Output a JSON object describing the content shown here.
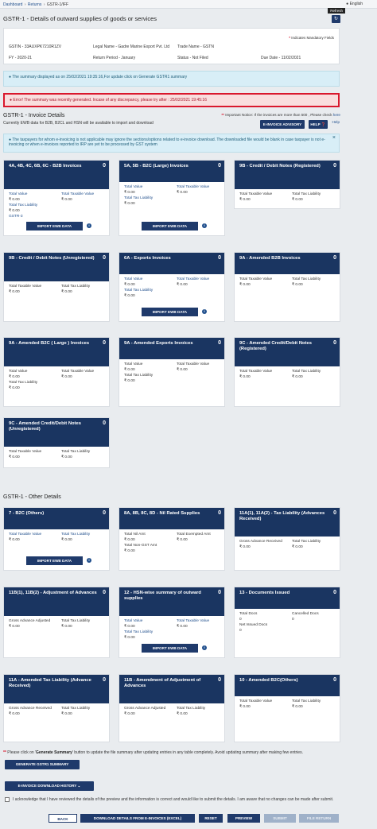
{
  "breadcrumb": {
    "items": [
      "Dashboard",
      "Returns",
      "GSTR-1/IFF"
    ],
    "sep": "›"
  },
  "language": "English",
  "refresh_tooltip": "Refresh",
  "refresh_glyph": "↻",
  "page_title": "GSTR-1 - Details of outward supplies of goods or services",
  "info": {
    "mandatory_star": "*",
    "mandatory": "Indicates Mandatory Fields",
    "gstin": "GSTIN - 33AUXPK7210R1ZV",
    "legal_name": "Legal Name - Gadre Marine Export Pvt. Ltd",
    "trade_name": "Trade Name - GSTN",
    "fy": "FY - 2020-21",
    "return_period": "Return Period - January",
    "status": "Status - Not Filed",
    "due_date": "Due Date - 11/02/2021"
  },
  "alert_summary": "The summary displayed as on 25/02/2021 19:35:16,For update click on Generate GSTR1 summary",
  "alert_error": "Error! The summary was recently generated. Incase of any discrepancy, please try after : 25/02/2021 19:45:16",
  "invoice_section": {
    "title": "GSTR-1 - Invoice Details",
    "subtitle": "Currently EWB data for B2B, B2CL and HSN will be available to import and download",
    "notice_stars": "**",
    "notice": "Important Notice: If the invoices are more than 500 , Please check",
    "notice_link": "here",
    "einvoice_btn": "E-INVOICE ADVISORY",
    "help_btn": "HELP",
    "help_icon": "❓",
    "help_text": "Help"
  },
  "alert_einvoice": "The taxpayers for whom e-invoicing is not applicable may ignore the sections/options related to e-invoice download. The downloaded file would be blank in case taxpayer is not e-invoicing or when e-invoices reported to IRP are yet to be processed by GST system",
  "tiles": [
    {
      "title": "4A, 4B, 4C, 6B, 6C - B2B Invoices",
      "count": "0",
      "l1": "Total Value",
      "v1": "₹ 0.00",
      "l2": "Total Taxable Value",
      "v2": "₹ 0.00",
      "l3": "Total Tax Liability",
      "v3": "₹ 0.00",
      "extra": "GSTR-3",
      "btn": "IMPORT EWB DATA"
    },
    {
      "title": "5A, 5B - B2C (Large) Invoices",
      "count": "0",
      "l1": "Total Value",
      "v1": "₹ 0.00",
      "l2": "Total Taxable Value",
      "v2": "₹ 0.00",
      "l3": "Total Tax Liability",
      "v3": "₹ 0.00",
      "btn": "IMPORT EWB DATA"
    },
    {
      "title": "9B - Credit / Debit Notes (Registered)",
      "count": "0",
      "l1": "Total Taxable Value",
      "v1": "₹ 0.00",
      "l2": "Total Tax Liability",
      "v2": "₹ 0.00"
    },
    {
      "title": "9B - Credit / Debit Notes (Unregistered)",
      "count": "0",
      "l1": "Total Taxable Value",
      "v1": "₹ 0.00",
      "l2": "Total Tax Liability",
      "v2": "₹ 0.00"
    },
    {
      "title": "6A - Exports Invoices",
      "count": "0",
      "l1": "Total Value",
      "v1": "₹ 0.00",
      "l2": "Total Taxable Value",
      "v2": "₹ 0.00",
      "l3": "Total Tax Liability",
      "v3": "₹ 0.00",
      "btn": "IMPORT EWB DATA"
    },
    {
      "title": "9A - Amended B2B Invoices",
      "count": "0",
      "l1": "Total Taxable Value",
      "v1": "₹ 0.00",
      "l2": "Total Tax Liability",
      "v2": "₹ 0.00"
    },
    {
      "title": "9A - Amended B2C ( Large ) Invoices",
      "count": "0",
      "l1": "Total Value",
      "v1": "₹ 0.00",
      "l2": "Total Taxable Value",
      "v2": "₹ 0.00",
      "l3": "Total Tax Liability",
      "v3": "₹ 0.00"
    },
    {
      "title": "9A - Amended Exports Invoices",
      "count": "0",
      "l1": "Total Value",
      "v1": "₹ 0.00",
      "l2": "Total Taxable Value",
      "v2": "₹ 0.00",
      "l3": "Total Tax Liability",
      "v3": "₹ 0.00"
    },
    {
      "title": "9C - Amended Credit/Debit Notes (Registered)",
      "count": "0",
      "l1": "Total Taxable Value",
      "v1": "₹ 0.00",
      "l2": "Total Tax Liability",
      "v2": "₹ 0.00"
    },
    {
      "title": "9C - Amended Credit/Debit Notes (Unregistered)",
      "count": "0",
      "l1": "Total Taxable Value",
      "v1": "₹ 0.00",
      "l2": "Total Tax Liability",
      "v2": "₹ 0.00"
    }
  ],
  "other_section_title": "GSTR-1 - Other Details",
  "other_tiles": [
    {
      "title": "7 - B2C (Others)",
      "count": "0",
      "l1": "Total Taxable Value",
      "v1": "₹ 0.00",
      "l2": "Total Tax Liability",
      "v2": "₹ 0.00",
      "btn": "IMPORT EWB DATA"
    },
    {
      "title": "8A, 8B, 8C, 8D - Nil Rated Supplies",
      "count": "0",
      "l1": "Total Nil Amt",
      "v1": "₹ 0.00",
      "l2": "Total Exempted Amt",
      "v2": "₹ 0.00",
      "l3": "Total Non-GST Amt",
      "v3": "₹ 0.00"
    },
    {
      "title": "11A(1), 11A(2) - Tax Liability (Advances Received)",
      "count": "0",
      "l1": "Gross Advance Received",
      "v1": "₹ 0.00",
      "l2": "Total Tax Liability",
      "v2": "₹ 0.00"
    },
    {
      "title": "11B(1), 11B(2) - Adjustment of Advances",
      "count": "0",
      "l1": "Gross Advance Adjusted",
      "v1": "₹ 0.00",
      "l2": "Total Tax Liability",
      "v2": "₹ 0.00"
    },
    {
      "title": "12 - HSN-wise summary of outward supplies",
      "count": "0",
      "l1": "Total Value",
      "v1": "₹ 0.00",
      "l2": "Total Taxable Value",
      "v2": "₹ 0.00",
      "l3": "Total Tax Liability",
      "v3": "₹ 0.00",
      "btn": "IMPORT EWB DATA"
    },
    {
      "title": "13 - Documents Issued",
      "count": "0",
      "l1": "Total Docs",
      "v1": "0",
      "l2": "Cancelled Docs",
      "v2": "0",
      "l3": "Net Issued Docs",
      "v3": "0"
    },
    {
      "title": "11A - Amended Tax Liability (Advance Received)",
      "count": "0",
      "l1": "Gross Advance Received",
      "v1": "₹ 0.00",
      "l2": "Total Tax Liability",
      "v2": "₹ 0.00"
    },
    {
      "title": "11B - Amendment of Adjustment of Advances",
      "count": "0",
      "l1": "Gross Advance Adjusted",
      "v1": "₹ 0.00",
      "l2": "Total Tax Liability",
      "v2": "₹ 0.00"
    },
    {
      "title": "10 - Amended B2C(Others)",
      "count": "0",
      "l1": "Total Taxable Value",
      "v1": "₹ 0.00",
      "l2": "Total Tax Liability",
      "v2": "₹ 0.00"
    }
  ],
  "footer": {
    "note_stars": "**",
    "note_pre": "Please click on '",
    "note_bold": "Generate Summary",
    "note_post": "' button to update the file summary after updating entries in any table completely. Avoid updating summary after making few entries.",
    "generate_btn": "GENERATE GSTR1 SUMMARY",
    "einvoice_history_btn": "E-INVOICE DOWNLOAD HISTORY",
    "chevron": "⌄",
    "ack": "I acknowledge that I have reviewed the details of the preview and the information is correct and would like to submit the details. I am aware that no changes can be made after submit.",
    "back": "BACK",
    "download": "DOWNLOAD DETAILS FROM E-INVOICES (EXCEL)",
    "reset": "RESET",
    "preview": "PREVIEW",
    "submit": "SUBMIT",
    "file_return": "FILE RETURN"
  },
  "info_icon_glyph": "i",
  "colors": {
    "tile_header": "#1a3561",
    "button": "#1f3a6b",
    "error": "#d9182d",
    "link": "#1f4e8c"
  }
}
